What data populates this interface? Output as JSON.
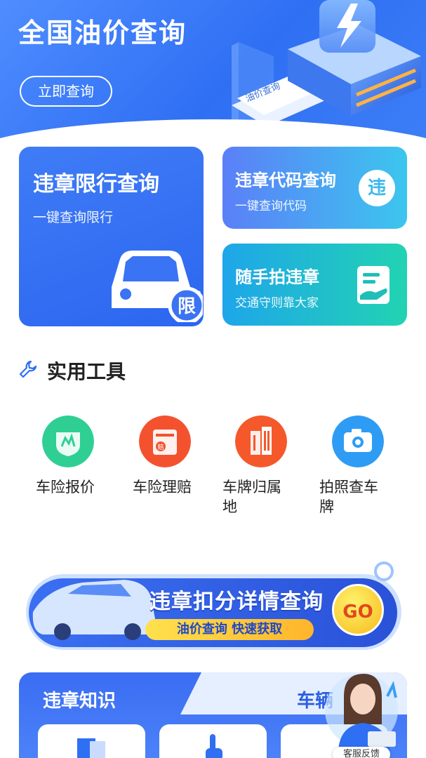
{
  "hero": {
    "title": "全国油价查询",
    "button_label": "立即查询",
    "illustration_label": "油价查询"
  },
  "cards": {
    "violation_limit": {
      "title": "违章限行查询",
      "subtitle": "一键查询限行",
      "badge": "限"
    },
    "violation_code": {
      "title": "违章代码查询",
      "subtitle": "一键查询代码",
      "badge": "违"
    },
    "snap_report": {
      "title": "随手拍违章",
      "subtitle": "交通守则靠大家"
    }
  },
  "tools": {
    "title": "实用工具",
    "items": [
      {
        "label": "车险报价",
        "icon": "car-insurance-quote-icon",
        "color": "#2fcf94"
      },
      {
        "label": "车险理赔",
        "icon": "insurance-claim-icon",
        "color": "#f4522f"
      },
      {
        "label": "车牌归属地",
        "icon": "building-icon",
        "color": "#f5582a"
      },
      {
        "label": "拍照查车牌",
        "icon": "camera-icon",
        "color": "#2e9cf5"
      }
    ]
  },
  "promo": {
    "title": "违章扣分详情查询",
    "subtitle": "油价查询 快速获取",
    "go": "GO"
  },
  "knowledge": {
    "title": "违章知识",
    "tab2": "车辆"
  },
  "customer_service": {
    "label": "客服反馈"
  }
}
